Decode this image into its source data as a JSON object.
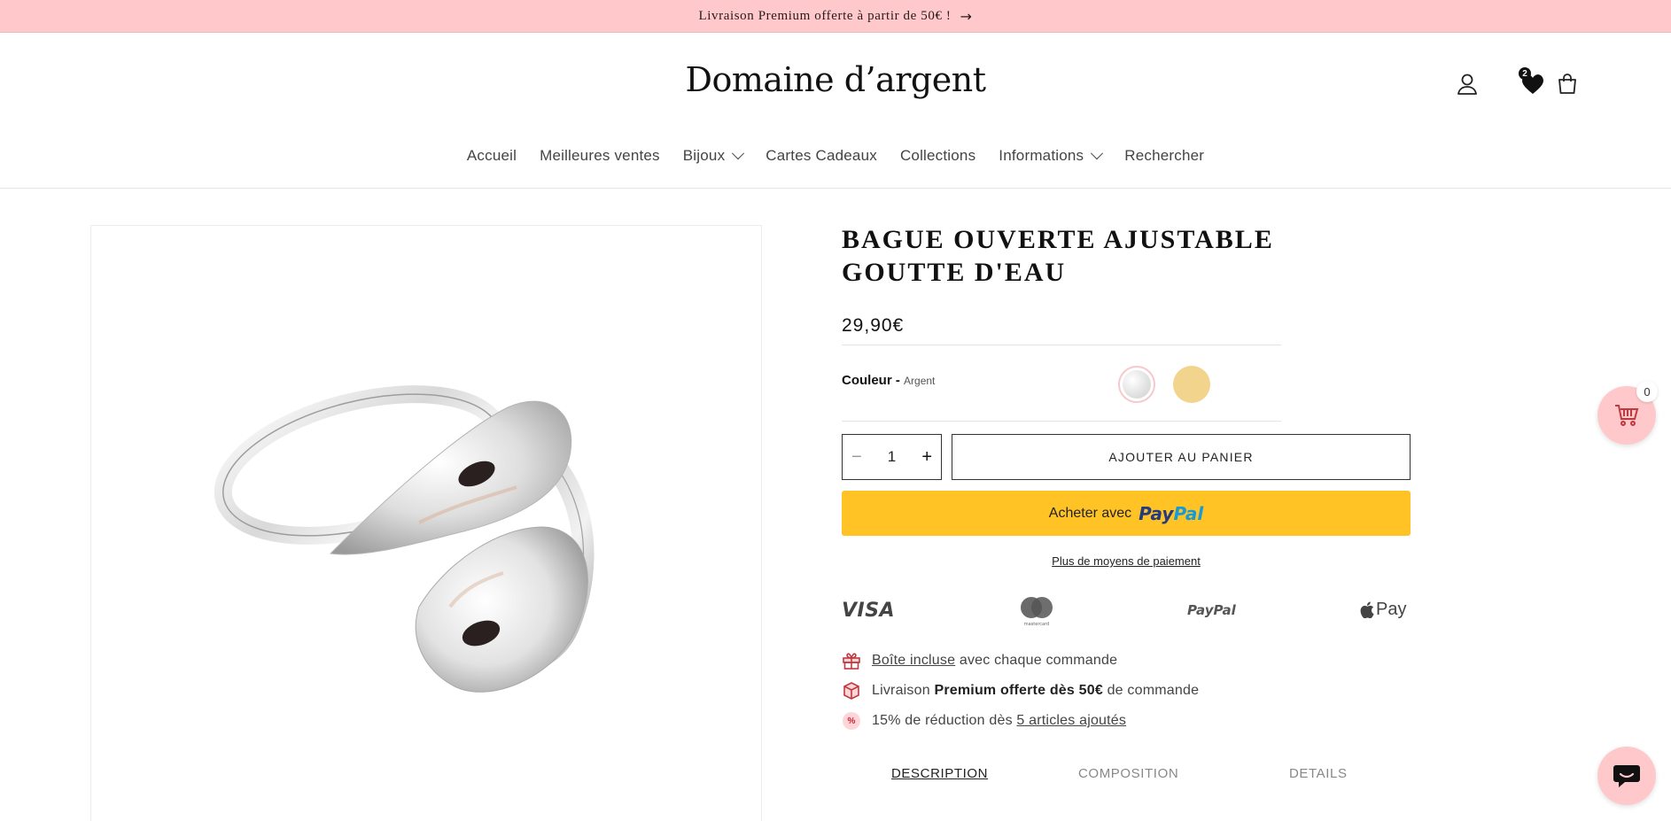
{
  "announcement": {
    "text": "Livraison Premium offerte à partir de 50€ !",
    "arrow": "→"
  },
  "header": {
    "logo": "Domaine d’argent",
    "wishlist_count": "2",
    "icons": [
      "account-icon",
      "heart-icon",
      "cart-icon"
    ]
  },
  "nav": {
    "items": [
      {
        "label": "Accueil"
      },
      {
        "label": "Meilleures ventes"
      },
      {
        "label": "Bijoux",
        "dropdown": true
      },
      {
        "label": "Cartes Cadeaux"
      },
      {
        "label": "Collections"
      },
      {
        "label": "Informations",
        "dropdown": true
      },
      {
        "label": "Rechercher"
      }
    ]
  },
  "product": {
    "title": "BAGUE OUVERTE AJUSTABLE GOUTTE D'EAU",
    "price": "29,90€",
    "color_label": "Couleur -",
    "color_value": "Argent",
    "swatches": [
      {
        "name": "Argent",
        "color": "#e4e4e4",
        "selected": true
      },
      {
        "name": "Or",
        "color": "#f3d48d",
        "selected": false
      }
    ],
    "quantity": "1",
    "minus": "−",
    "plus": "+",
    "add_to_cart": "AJOUTER AU PANIER",
    "paypal_prefix": "Acheter avec",
    "paypal_brand_1": "Pay",
    "paypal_brand_2": "Pal",
    "more_payment": "Plus de moyens de paiement"
  },
  "payment_logos": {
    "visa": "VISA",
    "mastercard_caption": "mastercard",
    "paypal": "PayPal",
    "apple_pay": "Pay"
  },
  "perks": {
    "box_link": "Boîte incluse",
    "box_rest": " avec chaque commande",
    "ship_pre": "Livraison ",
    "ship_bold": "Premium offerte dès 50€",
    "ship_post": " de commande",
    "discount_pre": "15% de réduction dès ",
    "discount_link": "5 articles ajoutés",
    "discount_icon": "%"
  },
  "tabs": [
    "DESCRIPTION",
    "COMPOSITION",
    "DETAILS"
  ],
  "floating_cart": {
    "count": "0"
  },
  "colors": {
    "accent_pink": "#ffc9cb",
    "paypal_yellow": "#ffc326"
  }
}
